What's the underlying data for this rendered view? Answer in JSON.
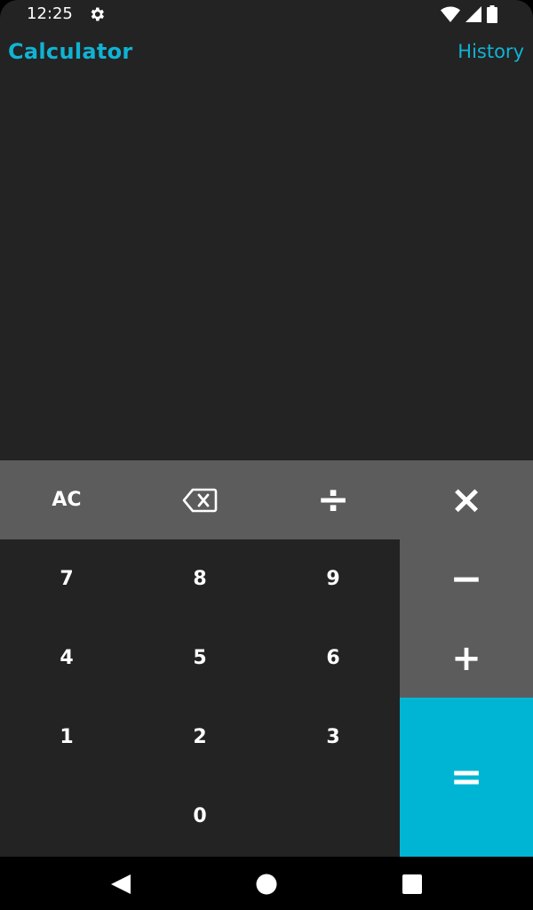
{
  "status_bar": {
    "time": "12:25"
  },
  "header": {
    "title": "Calculator",
    "history_label": "History"
  },
  "keypad": {
    "clear": "AC",
    "divide": "÷",
    "multiply": "×",
    "minus": "−",
    "plus": "+",
    "equals": "=",
    "digits": {
      "d7": "7",
      "d8": "8",
      "d9": "9",
      "d4": "4",
      "d5": "5",
      "d6": "6",
      "d1": "1",
      "d2": "2",
      "d3": "3",
      "d0": "0"
    }
  },
  "colors": {
    "accent": "#00b5d3",
    "title": "#10b3d4",
    "background": "#232323",
    "function_keys": "#5d5c5d"
  }
}
